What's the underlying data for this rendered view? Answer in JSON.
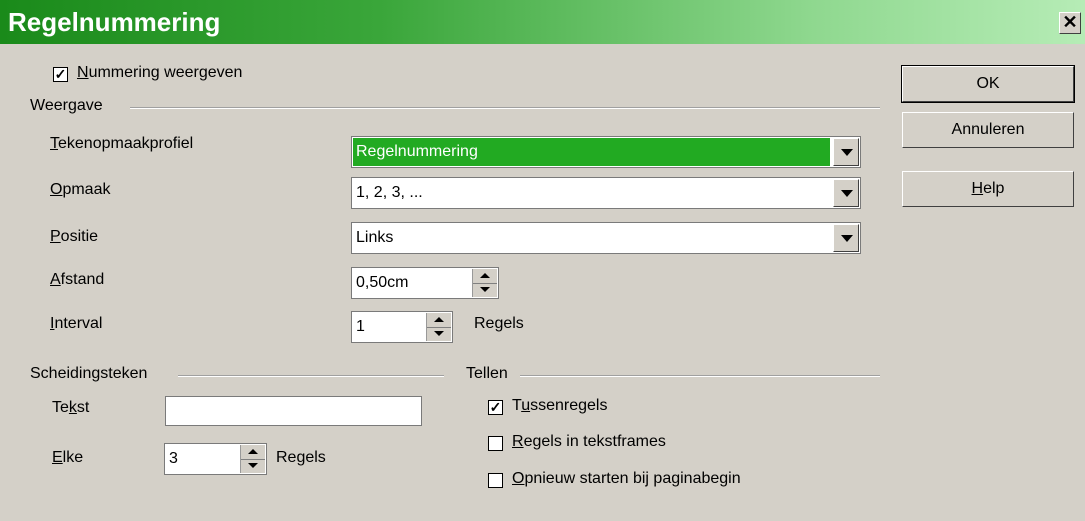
{
  "dialog": {
    "title": "Regelnummering",
    "close_glyph": "✕"
  },
  "show_numbering": {
    "label_prefix": "",
    "label_u": "N",
    "label_rest": "ummering weergeven",
    "checked": true
  },
  "weergave": {
    "heading": "Weergave",
    "char_style": {
      "label_u": "T",
      "label_rest": "ekenopmaakprofiel",
      "value": "Regelnummering"
    },
    "format": {
      "label_u": "O",
      "label_rest": "pmaak",
      "value": "1, 2, 3, ..."
    },
    "position": {
      "label_u": "P",
      "label_rest": "ositie",
      "value": "Links"
    },
    "spacing": {
      "label_u": "A",
      "label_rest": "fstand",
      "value": "0,50cm"
    },
    "interval": {
      "label_u": "I",
      "label_rest": "nterval",
      "value": "1",
      "unit": "Regels"
    }
  },
  "separator": {
    "heading": "Scheidingsteken",
    "text": {
      "label_pre": "Te",
      "label_u": "k",
      "label_rest": "st",
      "value": ""
    },
    "every": {
      "label_u": "E",
      "label_rest": "lke",
      "value": "3",
      "unit": "Regels"
    }
  },
  "count": {
    "heading": "Tellen",
    "blank_lines": {
      "label_pre": "T",
      "label_u": "u",
      "label_rest": "ssenregels",
      "checked": true
    },
    "text_frames": {
      "label_u": "R",
      "label_rest": "egels in tekstframes",
      "checked": false
    },
    "restart": {
      "label_u": "O",
      "label_rest": "pnieuw starten bij paginabegin",
      "checked": false
    }
  },
  "buttons": {
    "ok": "OK",
    "cancel": "Annuleren",
    "help_u": "H",
    "help_rest": "elp"
  },
  "colors": {
    "titlebar_start": "#1a8a1a",
    "titlebar_end": "#b6ecb6",
    "selected": "#22aa22",
    "dialog_bg": "#d4d0c8"
  }
}
